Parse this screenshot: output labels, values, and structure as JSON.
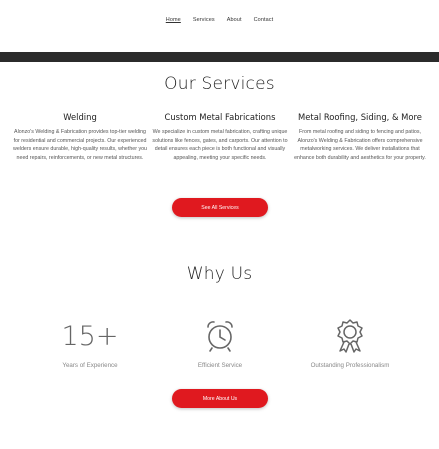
{
  "nav": {
    "items": [
      {
        "label": "Home",
        "active": true
      },
      {
        "label": "Services",
        "active": false
      },
      {
        "label": "About",
        "active": false
      },
      {
        "label": "Contact",
        "active": false
      }
    ]
  },
  "services": {
    "heading": "Our Services",
    "items": [
      {
        "title": "Welding",
        "text": "Alonzo's Welding & Fabrication provides top-tier welding for residential and commercial projects. Our experienced welders ensure durable, high-quality results, whether you need repairs, reinforcements, or new metal structures."
      },
      {
        "title": "Custom Metal Fabrications",
        "text": "We specialize in custom metal fabrication, crafting unique solutions like fences, gates, and carports. Our attention to detail ensures each piece is both functional and visually appealing, meeting your specific needs."
      },
      {
        "title": "Metal Roofing, Siding, & More",
        "text": "From metal roofing and siding to fencing and patios, Alonzo's Welding & Fabrication offers comprehensive metalworking services. We deliver installations that enhance both durability and aesthetics for your property."
      }
    ],
    "button": "See All Services"
  },
  "why": {
    "heading": "Why Us",
    "stats": [
      {
        "value": "15+",
        "label": "Years of Experience"
      },
      {
        "icon": "alarm-clock-icon",
        "label": "Efficient Service"
      },
      {
        "icon": "award-ribbon-icon",
        "label": "Outstanding Professionalism"
      }
    ],
    "button": "More About Us"
  },
  "colors": {
    "accent": "#e0191f",
    "band": "#2b2b2b"
  }
}
